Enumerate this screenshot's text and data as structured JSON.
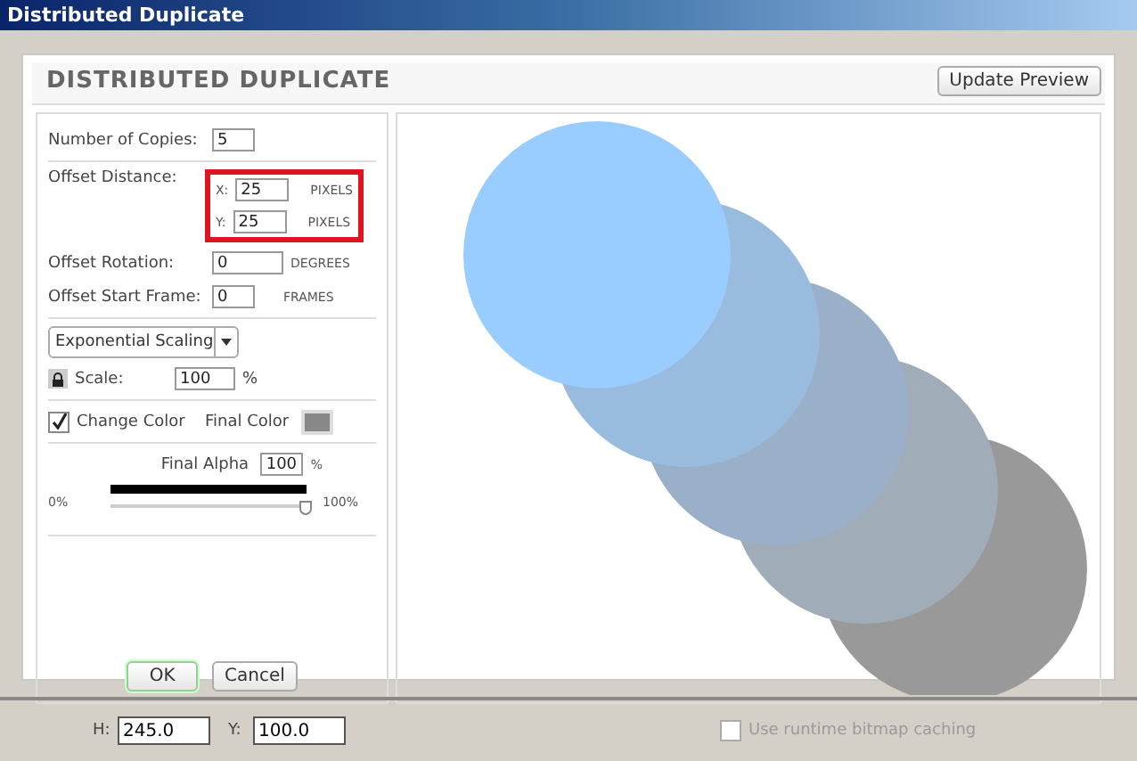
{
  "window": {
    "title": "Distributed Duplicate"
  },
  "dialog": {
    "heading": "DISTRIBUTED DUPLICATE",
    "update_button": "Update Preview",
    "copies": {
      "label": "Number of Copies:",
      "value": "5"
    },
    "offset_distance": {
      "label": "Offset Distance:",
      "highlighted": true,
      "x_label": "X:",
      "x_value": "25",
      "x_unit": "PIXELS",
      "y_label": "Y:",
      "y_value": "25",
      "y_unit": "PIXELS"
    },
    "offset_rotation": {
      "label": "Offset Rotation:",
      "value": "0",
      "unit": "DEGREES"
    },
    "offset_start_frame": {
      "label": "Offset Start Frame:",
      "value": "0",
      "unit": "FRAMES"
    },
    "scaling": {
      "mode": "Exponential Scaling",
      "scale_label": "Scale:",
      "scale_value": "100",
      "unit": "%"
    },
    "change_color": {
      "label": "Change Color",
      "checked": true,
      "final_color_label": "Final Color"
    },
    "final_alpha": {
      "label": "Final Alpha",
      "value": "100",
      "unit": "%",
      "min_label": "0%",
      "max_label": "100%",
      "level": 1
    },
    "ok_button": "OK",
    "cancel_button": "Cancel"
  },
  "status_bar": {
    "h_label": "H:",
    "h_value": "245.0",
    "y_label": "Y:",
    "y_value": "100.0",
    "bitmap_caching": {
      "label": "Use runtime bitmap caching",
      "checked": false,
      "disabled": true
    }
  }
}
